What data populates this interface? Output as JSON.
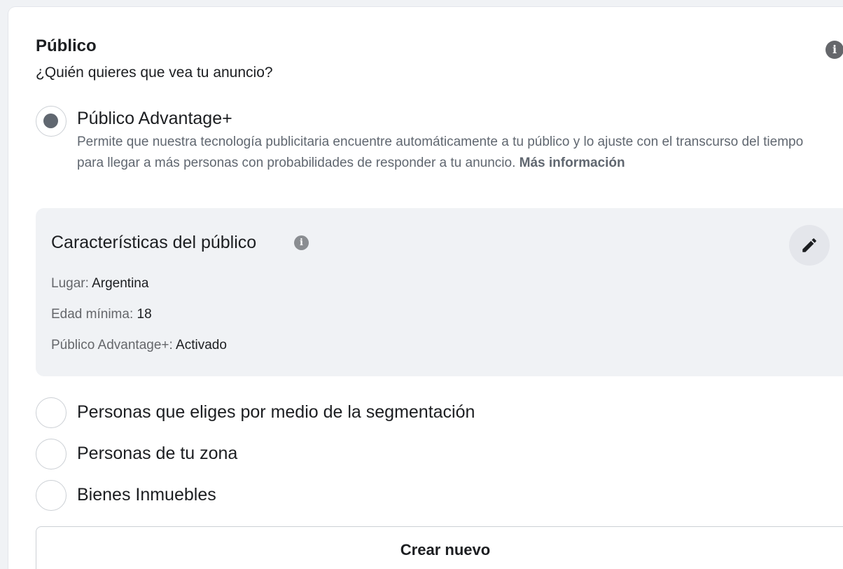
{
  "section": {
    "title": "Público",
    "subtitle": "¿Quién quieres que vea tu anuncio?",
    "info_icon": "info-icon"
  },
  "options": [
    {
      "label": "Público Advantage+",
      "selected": true,
      "description": "Permite que nuestra tecnología publicitaria encuentre automáticamente a tu público y lo ajuste con el transcurso del tiempo para llegar a más personas con probabilidades de responder a tu anuncio.",
      "more_link": "Más información"
    },
    {
      "label": "Personas que eliges por medio de la segmentación",
      "selected": false
    },
    {
      "label": "Personas de tu zona",
      "selected": false
    },
    {
      "label": "Bienes Inmuebles",
      "selected": false
    }
  ],
  "audience": {
    "title": "Características del público",
    "info_icon": "info-icon",
    "edit_icon": "pencil-icon",
    "attributes": [
      {
        "label": "Lugar:",
        "value": "Argentina"
      },
      {
        "label": "Edad mínima:",
        "value": "18"
      },
      {
        "label": "Público Advantage+:",
        "value": "Activado"
      }
    ]
  },
  "create_button": "Crear nuevo"
}
